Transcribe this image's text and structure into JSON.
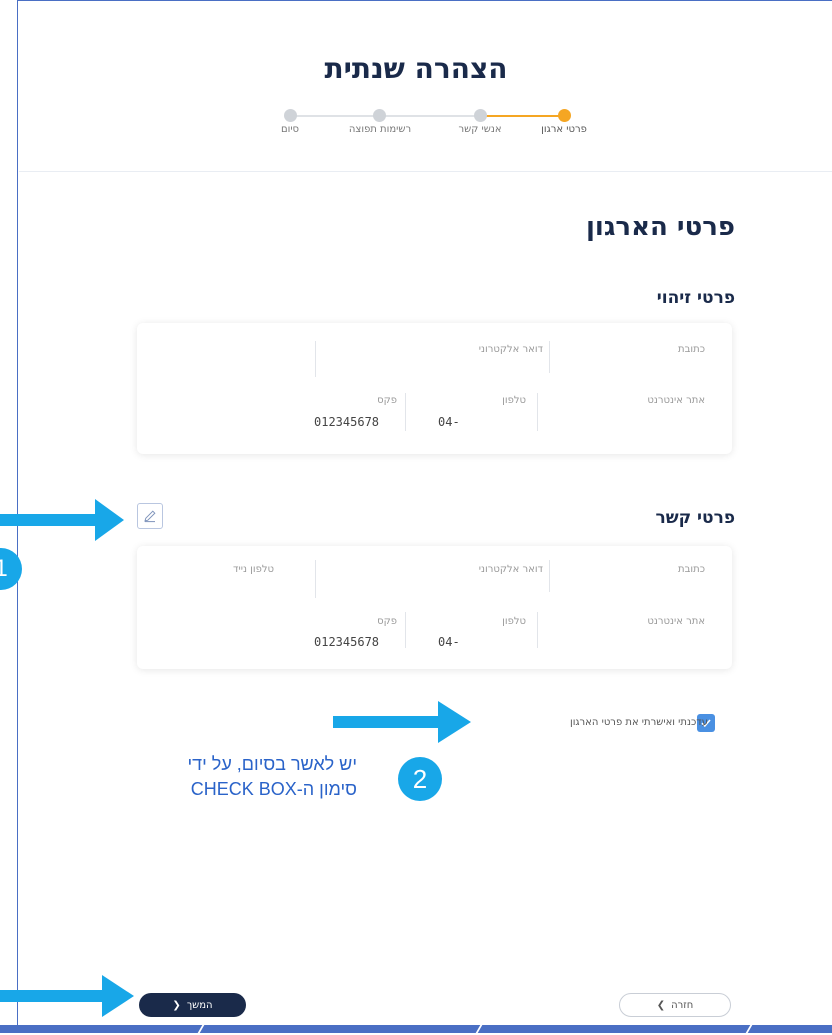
{
  "header": {
    "title": "הצהרה שנתית",
    "steps": [
      {
        "label": "פרטי ארגון",
        "active": true
      },
      {
        "label": "אנשי קשר",
        "active": false
      },
      {
        "label": "רשימות תפוצה",
        "active": false
      },
      {
        "label": "סיום",
        "active": false
      }
    ]
  },
  "page": {
    "title": "פרטי הארגון"
  },
  "identity": {
    "title": "פרטי זיהוי",
    "address_label": "כתובת",
    "email_label": "דואר אלקטרוני",
    "website_label": "אתר אינטרנט",
    "phone_label": "טלפון",
    "phone_value": "04-",
    "fax_label": "פקס",
    "fax_value": "012345678"
  },
  "contact": {
    "title": "פרטי קשר",
    "address_label": "כתובת",
    "email_label": "דואר אלקטרוני",
    "mobile_label": "טלפון נייד",
    "website_label": "אתר אינטרנט",
    "phone_label": "טלפון",
    "phone_value": "04-",
    "fax_label": "פקס",
    "fax_value": "012345678"
  },
  "confirm": {
    "label": "עדכנתי ואישרתי את פרטי הארגון",
    "checked": true
  },
  "annotation": {
    "badge1": "1",
    "badge2": "2",
    "line1": "יש לאשר בסיום, על ידי",
    "line2": "סימון ה-CHECK BOX"
  },
  "buttons": {
    "next": "המשך",
    "back": "חזרה"
  },
  "colors": {
    "accent": "#f5a623",
    "navy": "#1a2a4a",
    "annotation_blue": "#18a7e8",
    "checkbox_blue": "#4a90e2"
  }
}
